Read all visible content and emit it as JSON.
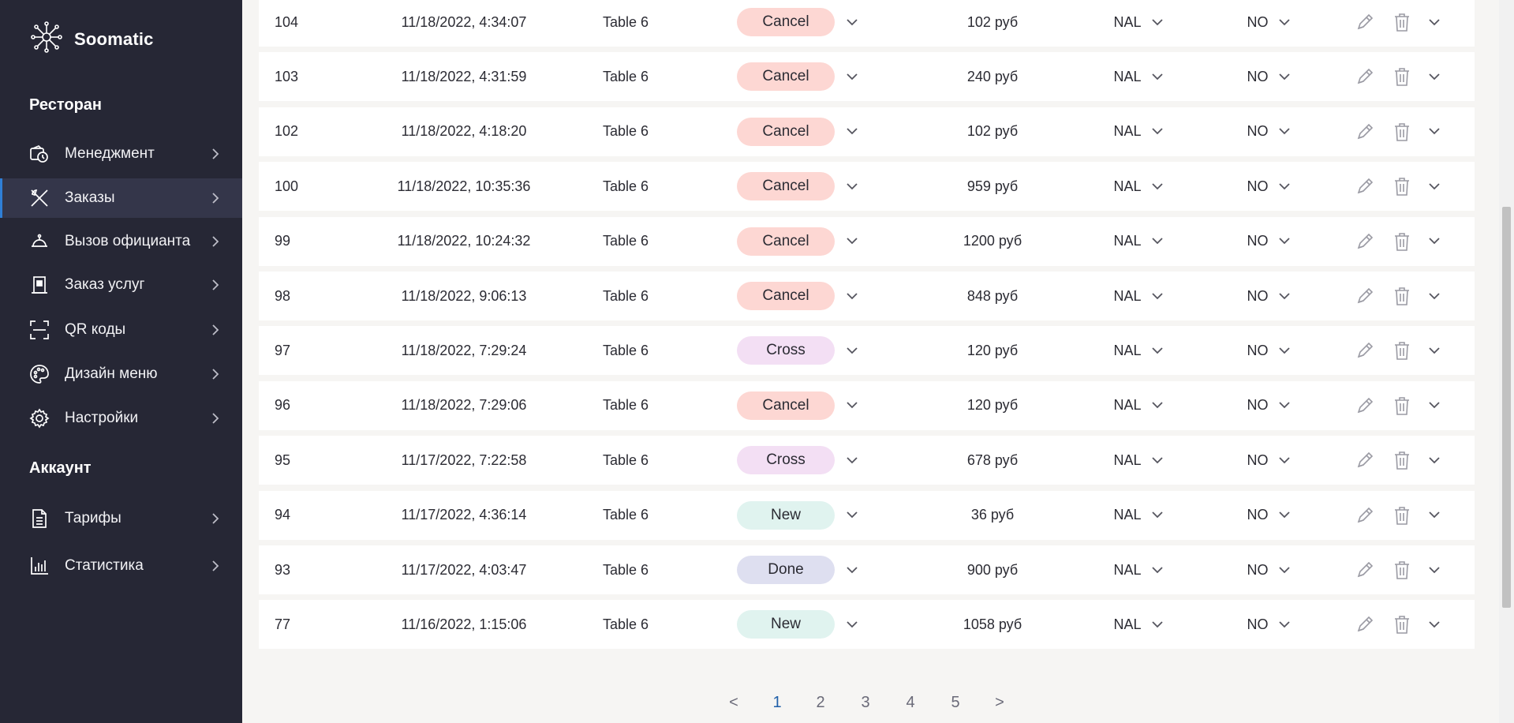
{
  "app": {
    "name": "Soomatic"
  },
  "sidebar": {
    "section_restaurant": "Ресторан",
    "section_account": "Аккаунт",
    "items": [
      {
        "label": "Менеджмент",
        "icon": "clock-wallet-icon"
      },
      {
        "label": "Заказы",
        "icon": "utensils-icon",
        "active": true
      },
      {
        "label": "Вызов официанта",
        "icon": "bell-icon"
      },
      {
        "label": "Заказ услуг",
        "icon": "building-icon"
      },
      {
        "label": "QR коды",
        "icon": "qr-scan-icon"
      },
      {
        "label": "Дизайн меню",
        "icon": "palette-icon"
      },
      {
        "label": "Настройки",
        "icon": "gear-icon"
      }
    ],
    "account_items": [
      {
        "label": "Тарифы",
        "icon": "document-icon"
      },
      {
        "label": "Статистика",
        "icon": "bar-chart-icon"
      }
    ]
  },
  "orders": [
    {
      "id": "104",
      "datetime": "11/18/2022, 4:34:07",
      "table": "Table 6",
      "status": "Cancel",
      "sum": "102 руб",
      "payment": "NAL",
      "paid": "NO"
    },
    {
      "id": "103",
      "datetime": "11/18/2022, 4:31:59",
      "table": "Table 6",
      "status": "Cancel",
      "sum": "240 руб",
      "payment": "NAL",
      "paid": "NO"
    },
    {
      "id": "102",
      "datetime": "11/18/2022, 4:18:20",
      "table": "Table 6",
      "status": "Cancel",
      "sum": "102 руб",
      "payment": "NAL",
      "paid": "NO"
    },
    {
      "id": "100",
      "datetime": "11/18/2022, 10:35:36",
      "table": "Table 6",
      "status": "Cancel",
      "sum": "959 руб",
      "payment": "NAL",
      "paid": "NO"
    },
    {
      "id": "99",
      "datetime": "11/18/2022, 10:24:32",
      "table": "Table 6",
      "status": "Cancel",
      "sum": "1200 руб",
      "payment": "NAL",
      "paid": "NO"
    },
    {
      "id": "98",
      "datetime": "11/18/2022, 9:06:13",
      "table": "Table 6",
      "status": "Cancel",
      "sum": "848 руб",
      "payment": "NAL",
      "paid": "NO"
    },
    {
      "id": "97",
      "datetime": "11/18/2022, 7:29:24",
      "table": "Table 6",
      "status": "Cross",
      "sum": "120 руб",
      "payment": "NAL",
      "paid": "NO"
    },
    {
      "id": "96",
      "datetime": "11/18/2022, 7:29:06",
      "table": "Table 6",
      "status": "Cancel",
      "sum": "120 руб",
      "payment": "NAL",
      "paid": "NO"
    },
    {
      "id": "95",
      "datetime": "11/17/2022, 7:22:58",
      "table": "Table 6",
      "status": "Cross",
      "sum": "678 руб",
      "payment": "NAL",
      "paid": "NO"
    },
    {
      "id": "94",
      "datetime": "11/17/2022, 4:36:14",
      "table": "Table 6",
      "status": "New",
      "sum": "36 руб",
      "payment": "NAL",
      "paid": "NO"
    },
    {
      "id": "93",
      "datetime": "11/17/2022, 4:03:47",
      "table": "Table 6",
      "status": "Done",
      "sum": "900 руб",
      "payment": "NAL",
      "paid": "NO"
    },
    {
      "id": "77",
      "datetime": "11/16/2022, 1:15:06",
      "table": "Table 6",
      "status": "New",
      "sum": "1058 руб",
      "payment": "NAL",
      "paid": "NO"
    }
  ],
  "pagination": {
    "prev": "<",
    "next": ">",
    "pages": [
      "1",
      "2",
      "3",
      "4",
      "5"
    ],
    "current": "1"
  },
  "colors": {
    "sidebar_bg": "#262735",
    "status_cancel": "#fdd7d3",
    "status_cross": "#f3dff4",
    "status_new": "#e0f3ef",
    "status_done": "#dedff0",
    "page_active": "#1f5fa8"
  }
}
